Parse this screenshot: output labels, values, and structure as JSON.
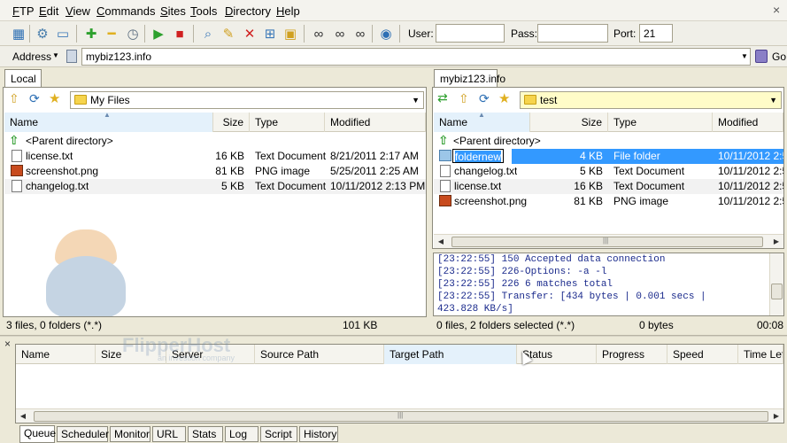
{
  "menu": [
    "FTP",
    "Edit",
    "View",
    "Commands",
    "Sites",
    "Tools",
    "Directory",
    "Help"
  ],
  "toolbar": {
    "user_label": "User:",
    "user_value": "",
    "pass_label": "Pass:",
    "pass_value": "",
    "port_label": "Port:",
    "port_value": "21"
  },
  "address": {
    "label": "Address",
    "value": "mybiz123.info",
    "go_label": "Go"
  },
  "local": {
    "tab": "Local",
    "path": "My Files",
    "columns": [
      "Name",
      "Size",
      "Type",
      "Modified"
    ],
    "parent": "<Parent directory>",
    "rows": [
      {
        "name": "license.txt",
        "size": "16 KB",
        "type": "Text Document",
        "modified": "8/21/2011 2:17 AM",
        "icon": "text-file"
      },
      {
        "name": "screenshot.png",
        "size": "81 KB",
        "type": "PNG image",
        "modified": "5/25/2011 2:25 AM",
        "icon": "image-file"
      },
      {
        "name": "changelog.txt",
        "size": "5 KB",
        "type": "Text Document",
        "modified": "10/11/2012 2:13 PM",
        "icon": "text-file"
      }
    ],
    "status_left": "3 files, 0 folders (*.*)",
    "status_right": "101 KB"
  },
  "remote": {
    "tab": "mybiz123.info",
    "path": "test",
    "columns": [
      "Name",
      "Size",
      "Type",
      "Modified"
    ],
    "parent": "<Parent directory>",
    "rows": [
      {
        "name": "foldernew",
        "size": "4 KB",
        "type": "File folder",
        "modified": "10/11/2012 2:5",
        "icon": "folder"
      },
      {
        "name": "changelog.txt",
        "size": "5 KB",
        "type": "Text Document",
        "modified": "10/11/2012 2:5",
        "icon": "text-file"
      },
      {
        "name": "license.txt",
        "size": "16 KB",
        "type": "Text Document",
        "modified": "10/11/2012 2:5",
        "icon": "text-file"
      },
      {
        "name": "screenshot.png",
        "size": "81 KB",
        "type": "PNG image",
        "modified": "10/11/2012 2:5",
        "icon": "image-file"
      }
    ],
    "log": [
      "[23:22:55] 150 Accepted data connection",
      "[23:22:55] 226-Options: -a -l",
      "[23:22:55] 226 6 matches total",
      "[23:22:55] Transfer: [434 bytes | 0.001 secs |",
      "423.828 KB/s]"
    ],
    "status_left": "0 files, 2 folders selected (*.*)",
    "status_mid": "0 bytes",
    "status_right": "00:08"
  },
  "queue": {
    "columns": [
      "Name",
      "Size",
      "Server",
      "Source Path",
      "Target Path",
      "Status",
      "Progress",
      "Speed",
      "Time Left"
    ],
    "tabs": [
      "Queue",
      "Scheduler",
      "Monitor",
      "URL",
      "Stats",
      "Log",
      "Script",
      "History"
    ]
  },
  "watermark": {
    "brand": "FlipperHost",
    "tagline": "an investion company"
  },
  "colors": {
    "selection": "#3399ff",
    "log_text": "#1a2a8c",
    "sorted_header": "#e4f1fb"
  }
}
